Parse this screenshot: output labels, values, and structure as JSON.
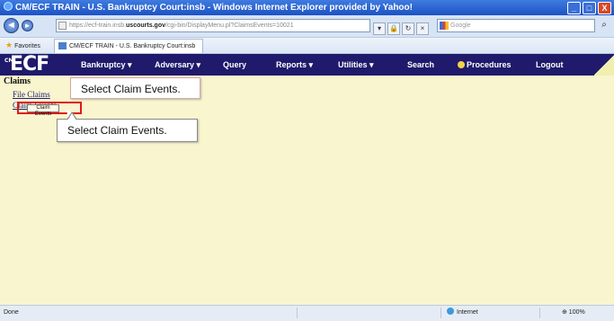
{
  "window": {
    "title": "CM/ECF TRAIN - U.S. Bankruptcy Court:insb - Windows Internet Explorer provided by Yahoo!",
    "min_glyph": "_",
    "max_glyph": "□",
    "close_glyph": "X"
  },
  "browser": {
    "back_glyph": "◄",
    "forward_glyph": "►",
    "address_prefix": "https://ecf-train.insb.",
    "address_domain": "uscourts.gov",
    "address_suffix": "/cgi-bin/DisplayMenu.pl?ClaimsEvents=10021",
    "search_placeholder": "Google",
    "search_glyph": "⌕",
    "favorites_label": "Favorites",
    "tab_title": "CM/ECF TRAIN - U.S. Bankruptcy Court:insb"
  },
  "ecf": {
    "logo": "ECF",
    "logo_prefix": "CM",
    "menu": {
      "bankruptcy": "Bankruptcy ▾",
      "adversary": "Adversary ▾",
      "query": "Query",
      "reports": "Reports ▾",
      "utilities": "Utilities ▾",
      "search": "Search",
      "procedures": "Procedures",
      "logout": "Logout"
    }
  },
  "content": {
    "heading": "Claims",
    "file_claims": "File Claims",
    "claim_events": "Claim Events",
    "tooltip": "Claim Events"
  },
  "callouts": {
    "top": "Select Claim Events.",
    "bottom": "Select Claim Events."
  },
  "status": {
    "done": "Done",
    "zone": "Internet",
    "zoom": "⊕ 100%"
  }
}
